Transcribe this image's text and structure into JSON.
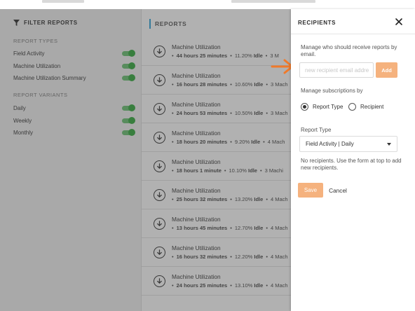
{
  "filters": {
    "title": "FILTER REPORTS",
    "report_types_label": "REPORT TYPES",
    "report_types": [
      {
        "label": "Field Activity",
        "enabled": true
      },
      {
        "label": "Machine Utilization",
        "enabled": true
      },
      {
        "label": "Machine Utilization Summary",
        "enabled": true
      }
    ],
    "report_variants_label": "REPORT VARIANTS",
    "report_variants": [
      {
        "label": "Daily",
        "enabled": true
      },
      {
        "label": "Weekly",
        "enabled": true
      },
      {
        "label": "Monthly",
        "enabled": true
      }
    ]
  },
  "reports": {
    "title": "REPORTS",
    "items": [
      {
        "name": "Machine Utilization",
        "hours": "44",
        "minutes": "25",
        "idle": "11.20%",
        "extra": "3 M"
      },
      {
        "name": "Machine Utilization",
        "hours": "16",
        "minutes": "28",
        "idle": "10.60%",
        "extra": "3 Mach"
      },
      {
        "name": "Machine Utilization",
        "hours": "24",
        "minutes": "53",
        "idle": "10.50%",
        "extra": "3 Mach"
      },
      {
        "name": "Machine Utilization",
        "hours": "18",
        "minutes": "20",
        "idle": "9.20%",
        "extra": "4 Mach"
      },
      {
        "name": "Machine Utilization",
        "hours": "18",
        "minutes": "1",
        "idle": "10.10%",
        "extra": "3 Machi"
      },
      {
        "name": "Machine Utilization",
        "hours": "25",
        "minutes": "32",
        "idle": "13.20%",
        "extra": "4 Mach"
      },
      {
        "name": "Machine Utilization",
        "hours": "13",
        "minutes": "45",
        "idle": "12.70%",
        "extra": "4 Mach"
      },
      {
        "name": "Machine Utilization",
        "hours": "16",
        "minutes": "32",
        "idle": "12.20%",
        "extra": "4 Mach"
      },
      {
        "name": "Machine Utilization",
        "hours": "24",
        "minutes": "25",
        "idle": "13.10%",
        "extra": "4 Mach"
      }
    ],
    "hours_unit": "hours",
    "minutes_unit": "minutes",
    "minute_unit": "minute",
    "idle_word": "Idle"
  },
  "recipients_panel": {
    "title": "RECIPIENTS",
    "description": "Manage who should receive reports by email.",
    "email_placeholder": "new recipient email addre",
    "add_label": "Add",
    "subscriptions_label": "Manage subscriptions by",
    "options": [
      "Report Type",
      "Recipient"
    ],
    "selected_option": "Report Type",
    "report_type_label": "Report Type",
    "report_type_value": "Field Activity | Daily",
    "empty_message": "No recipients. Use the form at top to add new recipients.",
    "save_label": "Save",
    "cancel_label": "Cancel"
  },
  "colors": {
    "toggle_on": "#2fa83a",
    "accent_orange": "#f5b27e",
    "pointer_orange": "#f07a2a",
    "header_bar": "#2aa0d8"
  }
}
